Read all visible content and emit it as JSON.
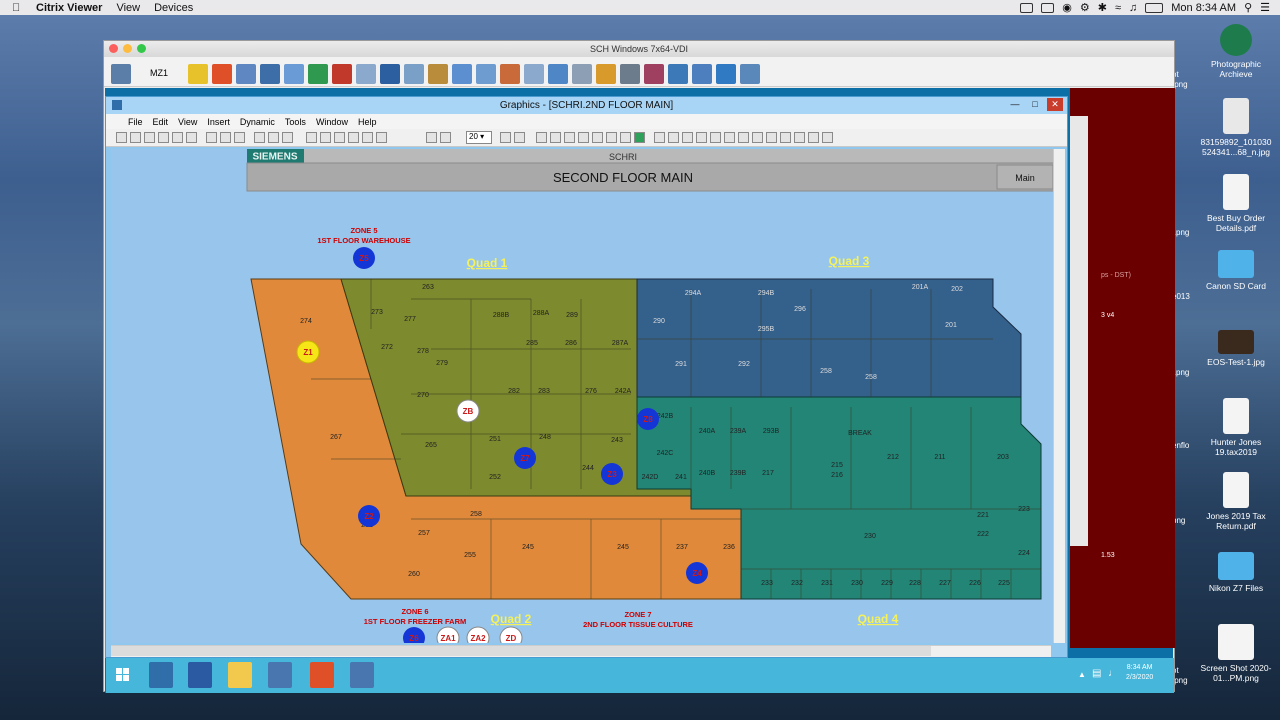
{
  "mac_menubar": {
    "app": "Citrix Viewer",
    "menus": [
      "View",
      "Devices"
    ],
    "clock": "Mon 8:34 AM"
  },
  "desktop_icons": [
    {
      "label": "Photographic Archieve"
    },
    {
      "label": "83159892_101030 524341...68_n.jpg"
    },
    {
      "label": "Best Buy Order Details.pdf"
    },
    {
      "label": "Canon SD Card"
    },
    {
      "label": "EOS-Test-1.jpg"
    },
    {
      "label": "Hunter Jones 19.tax2019"
    },
    {
      "label": "Jones 2019 Tax Return.pdf"
    },
    {
      "label": "Nikon Z7 Files"
    },
    {
      "label": "Screen Shot 2020-01...PM.png"
    }
  ],
  "desktop_partial_labels": [
    "ot",
    ".png",
    "l.png",
    "e013",
    "l.png",
    "enflo",
    "png",
    "ot",
    ".png"
  ],
  "citrix_window": {
    "title": "SCH Windows 7x64-VDI",
    "toolbar_label": "MZ1"
  },
  "graphics_window": {
    "title": "Graphics - [SCHRI.2ND FLOOR MAIN]",
    "menu": [
      "File",
      "Edit",
      "View",
      "Insert",
      "Dynamic",
      "Tools",
      "Window",
      "Help"
    ],
    "zoom_value": "20"
  },
  "graphic": {
    "brand": "SIEMENS",
    "site": "SCHRI",
    "floor_title": "SECOND FLOOR MAIN",
    "main_button": "Main",
    "quads": [
      "Quad 1",
      "Quad 2",
      "Quad 3",
      "Quad 4"
    ],
    "zone5_line1": "ZONE 5",
    "zone5_line2": "1ST FLOOR WAREHOUSE",
    "zone6_line1": "ZONE 6",
    "zone6_line2": "1ST FLOOR FREEZER FARM",
    "zone7_line1": "ZONE 7",
    "zone7_line2": "2ND FLOOR TISSUE CULTURE",
    "markers": {
      "z1": "Z1",
      "zb": "ZB",
      "z5": "Z5",
      "z8": "Z8",
      "z7": "Z7",
      "z3": "Z3",
      "z2": "Z2",
      "z4": "Z4",
      "z6": "Z6",
      "za1": "ZA1",
      "za2": "ZA2",
      "zd": "ZD"
    },
    "rooms_orange": [
      "274",
      "267",
      "262",
      "257",
      "260",
      "255",
      "258",
      "245",
      "245",
      "237",
      "236"
    ],
    "rooms_olive": [
      "263",
      "273",
      "277",
      "288B",
      "288A",
      "289",
      "272",
      "278",
      "285",
      "286",
      "287A",
      "279",
      "270",
      "282",
      "283",
      "276",
      "242A",
      "265",
      "251",
      "248",
      "243",
      "244",
      "252",
      "242D",
      "241"
    ],
    "rooms_blue": [
      "294A",
      "294B",
      "290",
      "296",
      "295B",
      "291",
      "292",
      "258",
      "258",
      "201A",
      "202",
      "201"
    ],
    "rooms_teal": [
      "242B",
      "240A",
      "239A",
      "293B",
      "242C",
      "240B",
      "239B",
      "217",
      "BREAK",
      "212",
      "211",
      "203",
      "215",
      "216",
      "221",
      "223",
      "222",
      "224",
      "230",
      "233",
      "232",
      "231",
      "230",
      "229",
      "228",
      "227",
      "226",
      "225"
    ]
  },
  "remote_partial_labels": [
    "ps - DST)",
    "3 v4",
    "1.53"
  ],
  "taskbar": {
    "time": "8:34 AM",
    "date": "2/3/2020"
  },
  "colors": {
    "orange_zone": "#e0893a",
    "olive_zone": "#7d8a2e",
    "blue_zone": "#34608c",
    "teal_zone": "#228576",
    "marker_blue": "#1436d6",
    "marker_yellow": "#f7e617",
    "quad_label": "#f5f259",
    "zone_label": "#cc0000"
  }
}
